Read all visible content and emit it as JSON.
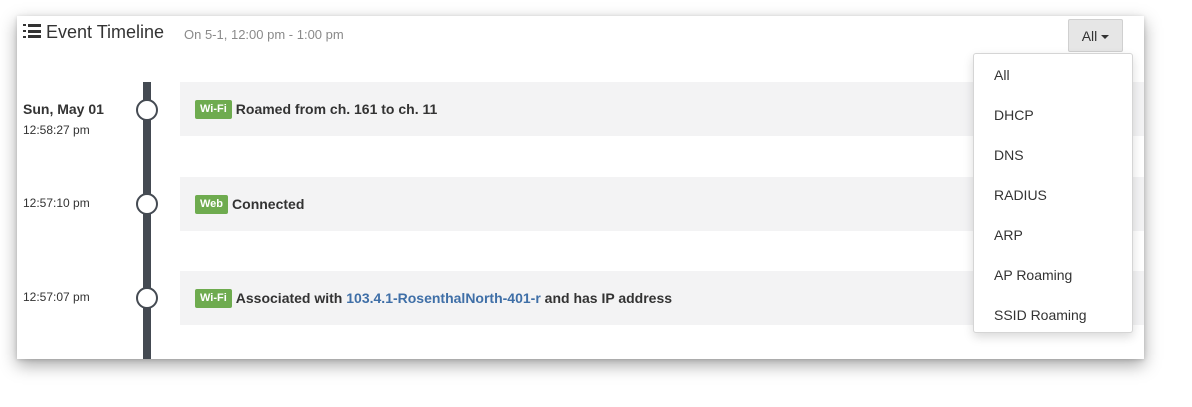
{
  "header": {
    "title": "Event Timeline",
    "subtitle": "On 5-1, 12:00 pm - 1:00 pm",
    "filter_label": "All"
  },
  "timeline": {
    "date": "Sun, May 01",
    "events": [
      {
        "time": "12:58:27 pm",
        "badge": "Wi-Fi",
        "text": "Roamed from ch. 161 to ch. 11"
      },
      {
        "time": "12:57:10 pm",
        "badge": "Web",
        "text": "Connected"
      },
      {
        "time": "12:57:07 pm",
        "badge": "Wi-Fi",
        "text_before": "Associated with",
        "link": "103.4.1-RosenthalNorth-401-r",
        "text_after": "and has IP address"
      }
    ]
  },
  "dropdown": {
    "items": [
      "All",
      "DHCP",
      "DNS",
      "RADIUS",
      "ARP",
      "AP Roaming",
      "SSID Roaming"
    ]
  },
  "colors": {
    "badge": "#6eab4f",
    "link": "#3f6fa7",
    "timeline_line": "#444a52",
    "card_background": "#f3f3f4"
  }
}
